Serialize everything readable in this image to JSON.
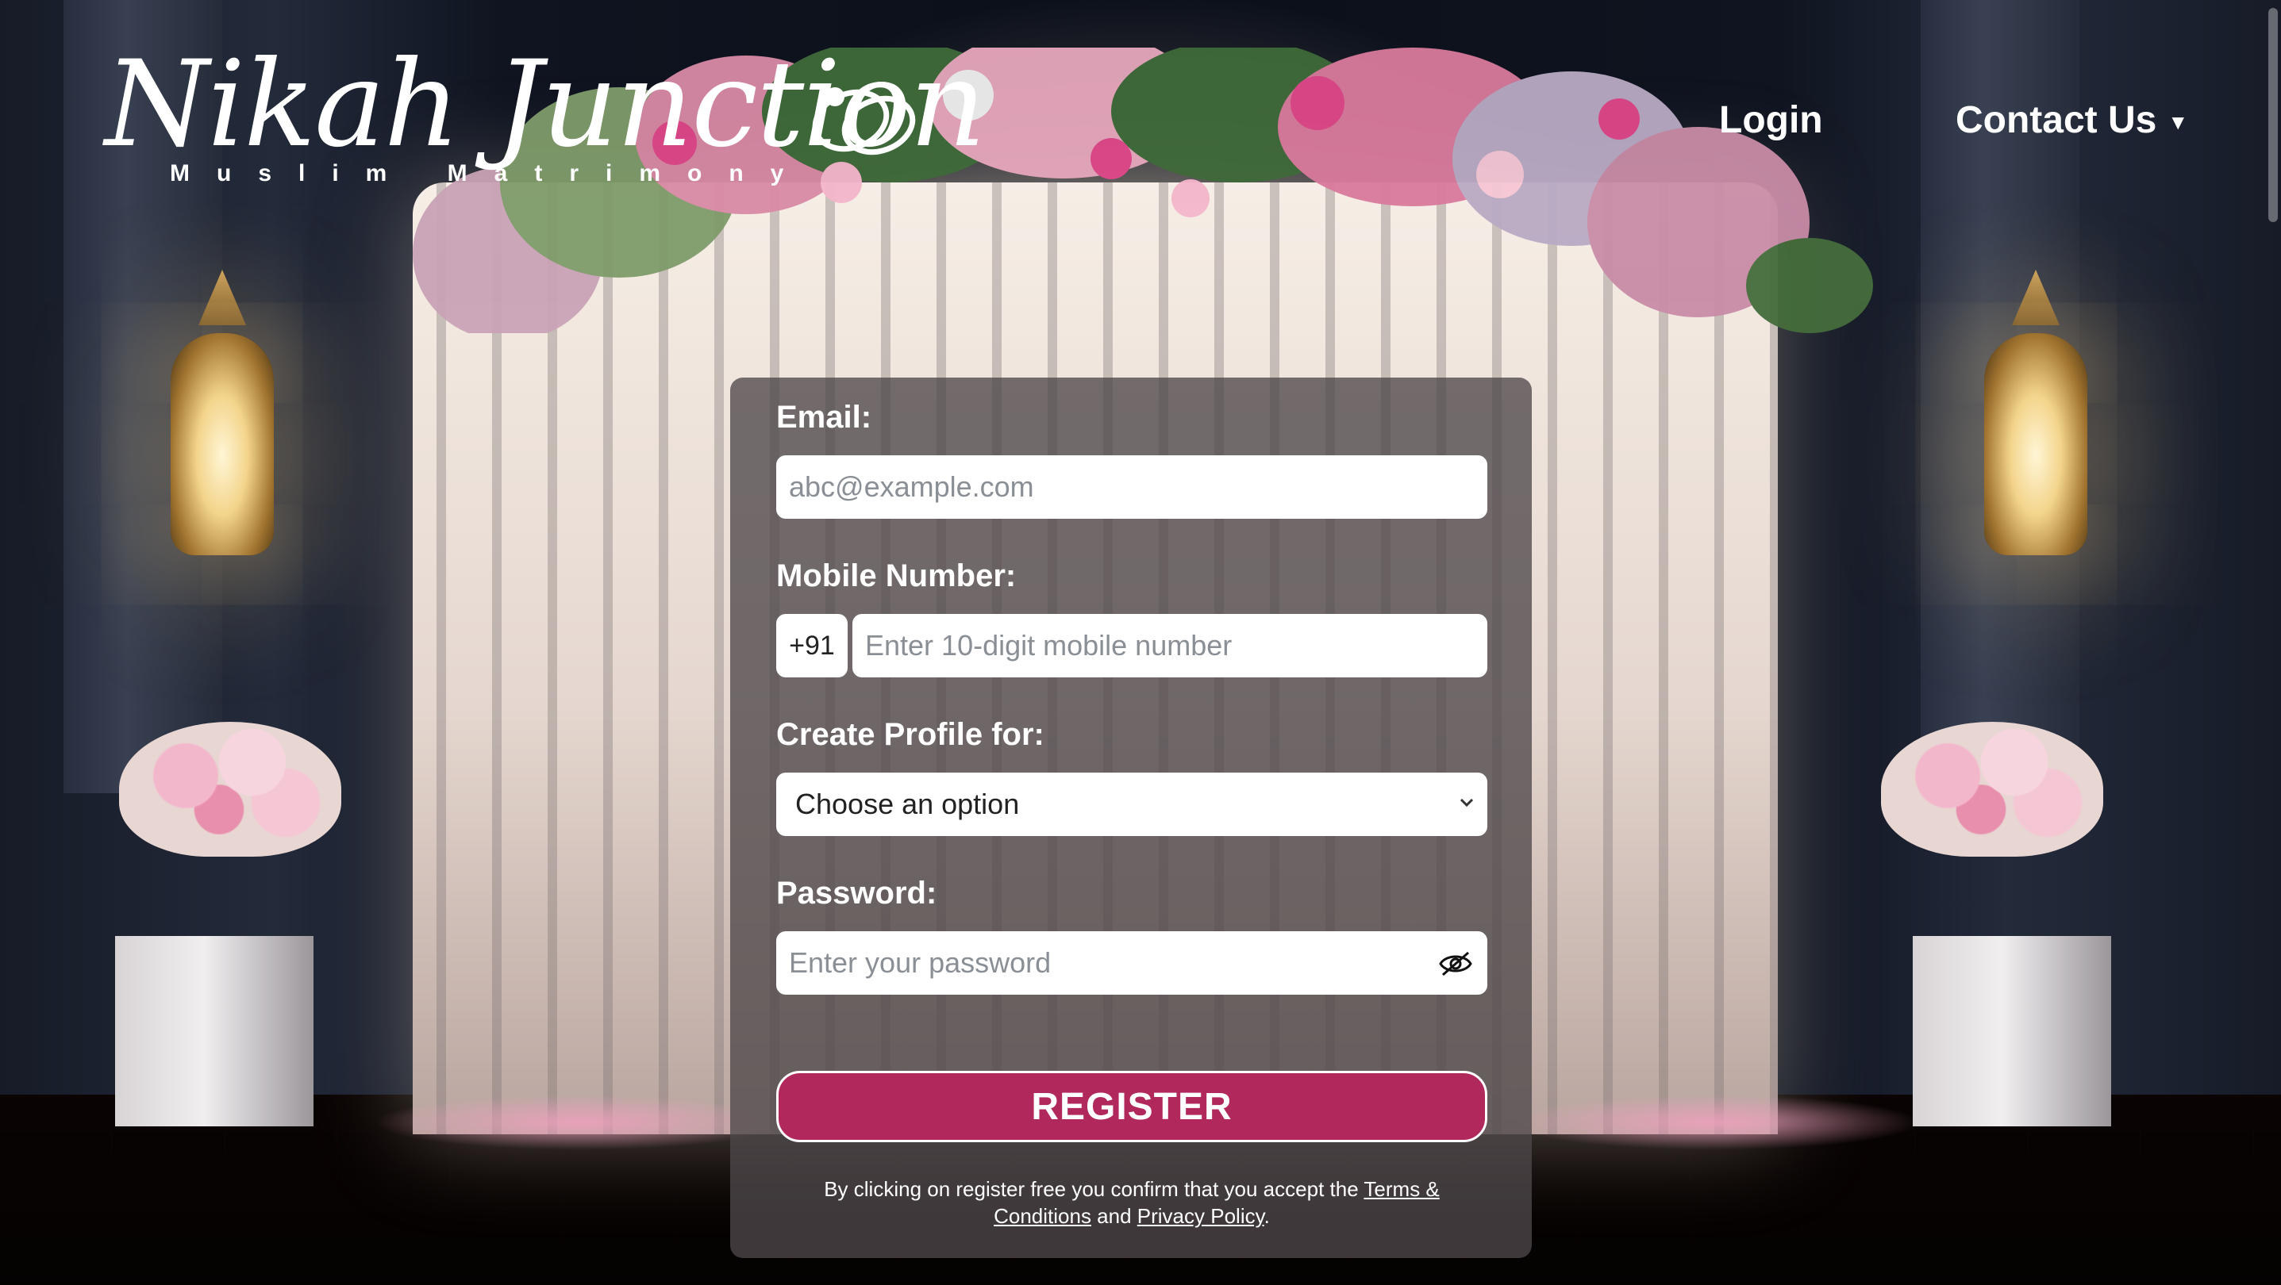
{
  "header": {
    "logo_title": "Nikah Junction",
    "logo_subtitle": "Muslim Matrimony",
    "nav": {
      "login_label": "Login",
      "contact_label": "Contact Us"
    }
  },
  "form": {
    "email": {
      "label": "Email:",
      "placeholder": "abc@example.com",
      "value": ""
    },
    "mobile": {
      "label": "Mobile Number:",
      "country_code": "+91",
      "placeholder": "Enter 10-digit mobile number",
      "value": ""
    },
    "profile_for": {
      "label": "Create Profile for:",
      "selected": "Choose an option"
    },
    "password": {
      "label": "Password:",
      "placeholder": "Enter your password",
      "value": ""
    },
    "register_label": "REGISTER",
    "terms": {
      "prefix": "By clicking on register free you confirm that you accept the ",
      "terms_link": "Terms & Conditions",
      "and": " and ",
      "privacy_link": "Privacy Policy",
      "suffix": "."
    }
  },
  "icons": {
    "logo_mark": "wedding-rings-icon",
    "contact_caret": "caret-down-icon",
    "select_chevron": "chevron-down-icon",
    "password_toggle": "eye-slash-icon"
  },
  "colors": {
    "accent": "#b0285c",
    "card_bg": "#4e484a",
    "text_light": "#ffffff"
  }
}
